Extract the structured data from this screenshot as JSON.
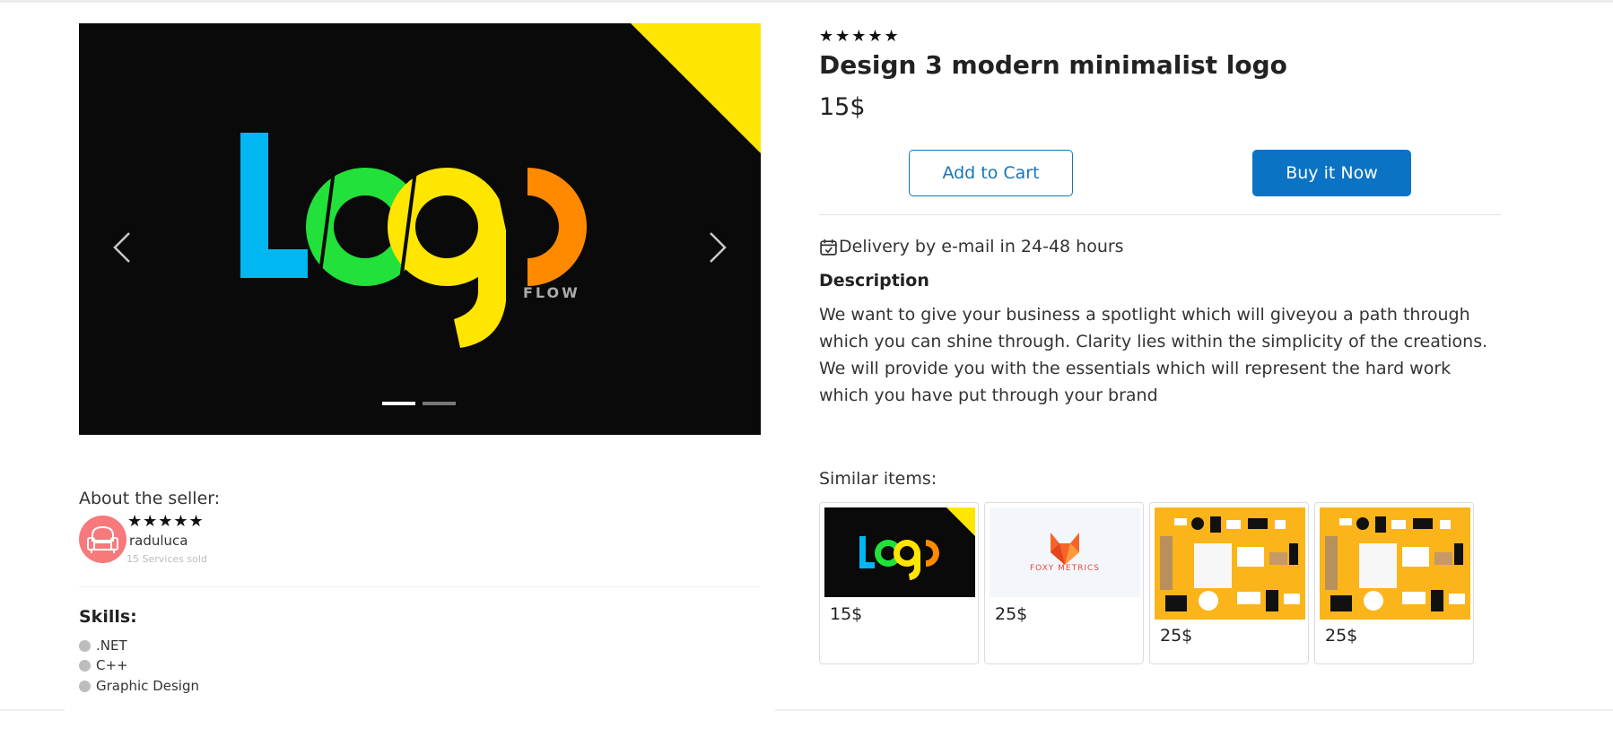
{
  "product": {
    "rating_stars": "★★★★★",
    "title": "Design 3 modern minimalist logo",
    "price": "15$",
    "add_to_cart_label": "Add to Cart",
    "buy_now_label": "Buy it Now",
    "delivery_text": "Delivery by e-mail in 24-48 hours",
    "description_heading": "Description",
    "description": "We want to give your business a spotlight which will giveyou a path through which you can shine through. Clarity lies within the simplicity of the creations. We will provide you with the essentials which will represent the hard work which you have put through your brand"
  },
  "carousel": {
    "logo_text": "FLOW",
    "slides_count": 2,
    "active_slide": 1,
    "accent_color": "#ffe600"
  },
  "similar": {
    "label": "Similar items:",
    "items": [
      {
        "price": "15$",
        "thumb": "logo-flow"
      },
      {
        "price": "25$",
        "thumb": "foxy-metrics",
        "brand_text": "FOXY METRICS"
      },
      {
        "price": "25$",
        "thumb": "stationery-mockup"
      },
      {
        "price": "25$",
        "thumb": "stationery-mockup"
      }
    ]
  },
  "seller": {
    "about_label": "About the seller:",
    "rating_stars": "★★★★★",
    "name": "raduluca",
    "services_sold": "15 Services sold"
  },
  "skills": {
    "heading": "Skills:",
    "items": [
      ".NET",
      "C++",
      "Graphic Design"
    ]
  },
  "colors": {
    "primary": "#0b73c3",
    "logo_blue": "#00b7f2",
    "logo_green": "#22e13a",
    "logo_yellow": "#ffe600",
    "logo_orange": "#ff8a00",
    "avatar_bg": "#f7797b"
  }
}
